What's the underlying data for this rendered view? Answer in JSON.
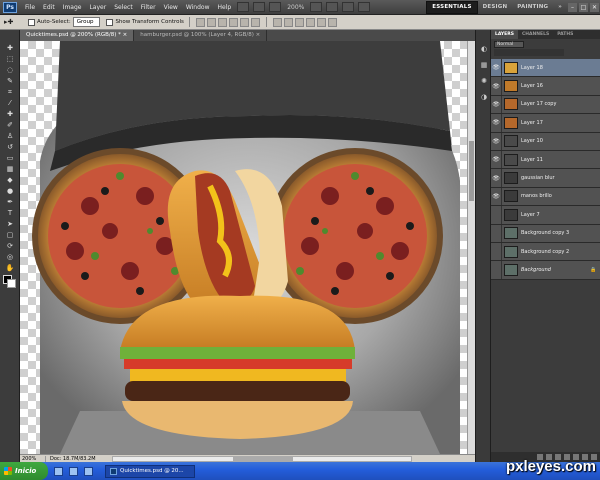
{
  "menubar": {
    "logo": "Ps",
    "items": [
      "File",
      "Edit",
      "Image",
      "Layer",
      "Select",
      "Filter",
      "View",
      "Window",
      "Help"
    ],
    "zoom": "200%",
    "workspaces": [
      "ESSENTIALS",
      "DESIGN",
      "PAINTING"
    ],
    "workspace_more": "»",
    "win_minimize": "–",
    "win_restore": "□",
    "win_close": "✕"
  },
  "optbar": {
    "tool_glyph": "▸✚",
    "auto_select_label": "Auto-Select:",
    "auto_select_value": "Group",
    "show_transform_label": "Show Transform Controls"
  },
  "doctabs": [
    {
      "label": "Quicktimes.psd @ 200% (RGB/8) *",
      "close": "×",
      "active": true
    },
    {
      "label": "hamburger.psd @ 100% (Layer 4, RGB/8)",
      "close": "×",
      "active": false
    }
  ],
  "status": {
    "zoom": "200%",
    "doc": "Doc: 18.7M/83.2M"
  },
  "layers_panel": {
    "tabs": [
      "LAYERS",
      "CHANNELS",
      "PATHS"
    ],
    "blend_mode": "Normal",
    "layers": [
      {
        "name": "Layer 18",
        "visible": true,
        "thumb": "#d9a33a",
        "selected": true,
        "lock": ""
      },
      {
        "name": "Layer 16",
        "visible": true,
        "thumb": "#c07a2a",
        "selected": false,
        "lock": ""
      },
      {
        "name": "Layer 17 copy",
        "visible": true,
        "thumb": "#b5682b",
        "selected": false,
        "lock": ""
      },
      {
        "name": "Layer 17",
        "visible": true,
        "thumb": "#b5682b",
        "selected": false,
        "lock": ""
      },
      {
        "name": "Layer 10",
        "visible": true,
        "thumb": "#4a4a4a",
        "selected": false,
        "lock": ""
      },
      {
        "name": "Layer 11",
        "visible": true,
        "thumb": "#4a4a4a",
        "selected": false,
        "lock": ""
      },
      {
        "name": "gaussian blur",
        "visible": true,
        "thumb": "#3b3b3b",
        "selected": false,
        "lock": ""
      },
      {
        "name": "manos brillo",
        "visible": true,
        "thumb": "#3b3b3b",
        "selected": false,
        "lock": ""
      },
      {
        "name": "Layer 7",
        "visible": false,
        "thumb": "#3b3b3b",
        "selected": false,
        "lock": ""
      },
      {
        "name": "Background copy 3",
        "visible": false,
        "thumb": "#5d6f68",
        "selected": false,
        "lock": ""
      },
      {
        "name": "Background copy 2",
        "visible": false,
        "thumb": "#5d6f68",
        "selected": false,
        "lock": ""
      },
      {
        "name": "Background",
        "visible": false,
        "thumb": "#5d6f68",
        "selected": false,
        "lock": "🔒",
        "italic": true
      }
    ]
  },
  "taskbar": {
    "start": "Inicio",
    "task": "Quicktimes.psd @ 20..."
  },
  "watermark": "pxleyes.com",
  "colors": {
    "ps_dark": "#3c3c3c",
    "selected_layer": "#6b7c93",
    "xp_blue": "#245edb",
    "xp_green": "#2e8b2e"
  }
}
